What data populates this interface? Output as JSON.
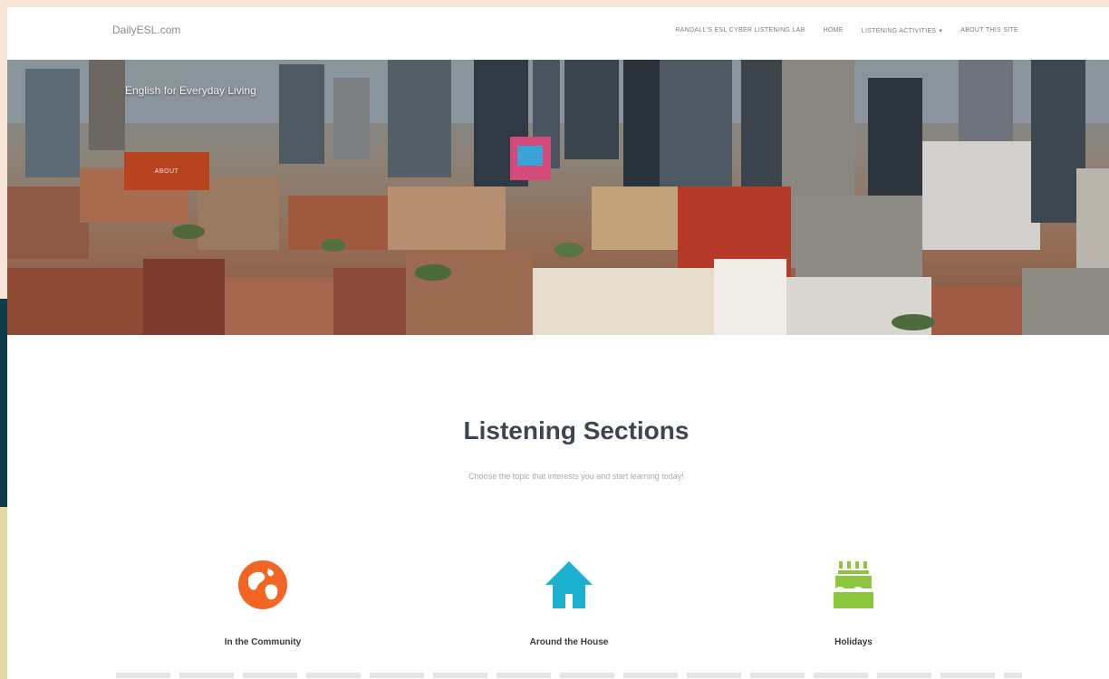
{
  "navbar": {
    "brand": "DailyESL.com",
    "links": [
      {
        "label": "RANDALL'S ESL CYBER LISTENING LAB"
      },
      {
        "label": "HOME"
      },
      {
        "label": "LISTENING ACTIVITIES",
        "has_dropdown": true
      },
      {
        "label": "ABOUT THIS SITE"
      }
    ]
  },
  "hero": {
    "tagline": "English for Everyday Living",
    "button_label": "ABOUT"
  },
  "main": {
    "title": "Listening Sections",
    "subtitle": "Choose the topic that interests you and start learning today!",
    "topics": [
      {
        "label": "In the Community",
        "icon": "globe-icon",
        "color": "#f26522"
      },
      {
        "label": "Around the House",
        "icon": "house-icon",
        "color": "#1bb0ce"
      },
      {
        "label": "Holidays",
        "icon": "birthday-cake-icon",
        "color": "#8cc63f"
      }
    ]
  },
  "colors": {
    "hero_button": "#b8431f",
    "title": "#3d4650",
    "background": "#f7e6d8"
  }
}
